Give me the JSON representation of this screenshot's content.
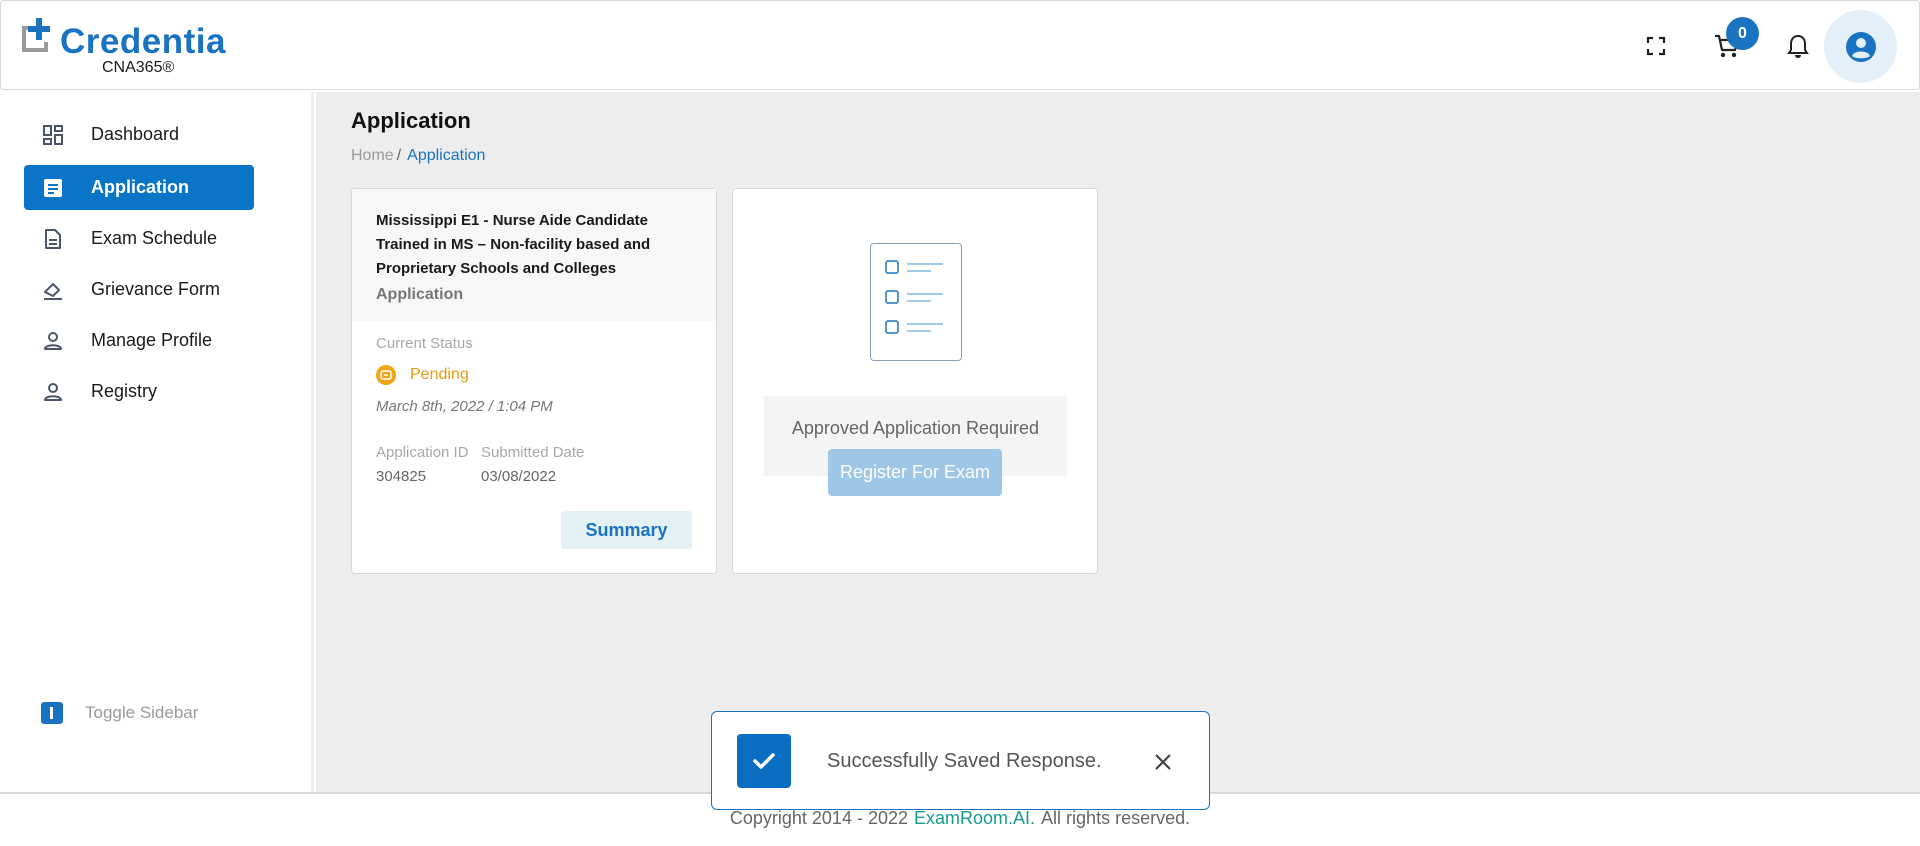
{
  "header": {
    "logo_text": "Credentia",
    "logo_sub": "CNA365®",
    "cart_count": "0",
    "icons": [
      "fullscreen-icon",
      "cart-icon",
      "bell-icon",
      "account-icon"
    ]
  },
  "sidebar": {
    "items": [
      {
        "label": "Dashboard",
        "icon": "dashboard-icon",
        "active": false
      },
      {
        "label": "Application",
        "icon": "application-icon",
        "active": true
      },
      {
        "label": "Exam Schedule",
        "icon": "document-icon",
        "active": false
      },
      {
        "label": "Grievance Form",
        "icon": "eraser-icon",
        "active": false
      },
      {
        "label": "Manage Profile",
        "icon": "person-icon",
        "active": false
      },
      {
        "label": "Registry",
        "icon": "person-icon",
        "active": false
      }
    ],
    "toggle_label": "Toggle Sidebar"
  },
  "main": {
    "title": "Application",
    "breadcrumb": {
      "home": "Home",
      "separator": "/",
      "current": "Application"
    },
    "application_card": {
      "title": "Mississippi E1 - Nurse Aide Candidate Trained in MS – Non-facility based and Proprietary Schools and Colleges",
      "type": "Application",
      "status_label": "Current Status",
      "status": "Pending",
      "status_date": "March 8th, 2022 / 1:04 PM",
      "app_id_label": "Application ID",
      "app_id": "304825",
      "submitted_label": "Submitted Date",
      "submitted_date": "03/08/2022",
      "summary_button": "Summary"
    },
    "register_card": {
      "message": "Approved Application Required",
      "button": "Register For Exam"
    }
  },
  "toast": {
    "message": "Successfully Saved Response."
  },
  "footer": {
    "copyright": "Copyright 2014 - 2022",
    "brand": "ExamRoom.AI.",
    "rights": "All rights reserved."
  },
  "colors": {
    "primary": "#0a74c6",
    "pending": "#e89b12",
    "footer_brand": "#1a9a8f"
  }
}
